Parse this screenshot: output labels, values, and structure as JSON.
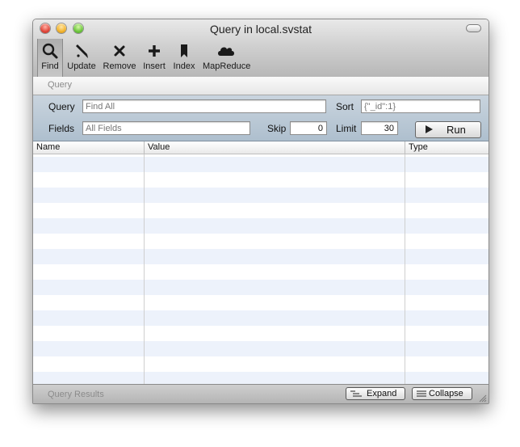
{
  "window": {
    "title": "Query in local.svstat"
  },
  "toolbar": {
    "items": [
      {
        "label": "Find",
        "icon": "magnifier-icon",
        "active": true
      },
      {
        "label": "Update",
        "icon": "pen-icon"
      },
      {
        "label": "Remove",
        "icon": "x-icon"
      },
      {
        "label": "Insert",
        "icon": "plus-icon"
      },
      {
        "label": "Index",
        "icon": "bookmark-icon"
      },
      {
        "label": "MapReduce",
        "icon": "cloud-icon"
      }
    ]
  },
  "tab": {
    "label": "Query"
  },
  "form": {
    "query_label": "Query",
    "query_placeholder": "Find All",
    "sort_label": "Sort",
    "sort_placeholder": "{\"_id\":1}",
    "fields_label": "Fields",
    "fields_placeholder": "All Fields",
    "skip_label": "Skip",
    "skip_value": "0",
    "limit_label": "Limit",
    "limit_value": "30",
    "run_label": "Run"
  },
  "results": {
    "columns": [
      "Name",
      "Value",
      "Type"
    ]
  },
  "footer": {
    "label": "Query Results",
    "expand_label": "Expand",
    "collapse_label": "Collapse"
  },
  "colors": {
    "form_bg": "#b9c7d4",
    "row_stripe": "#edf2fb"
  }
}
